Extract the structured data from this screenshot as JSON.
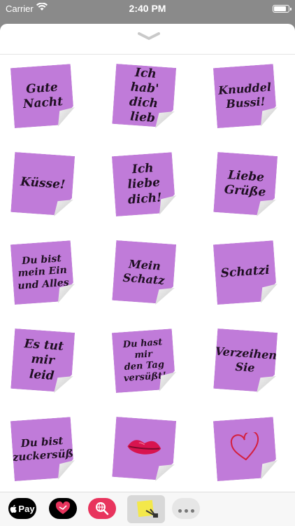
{
  "status_bar": {
    "carrier": "Carrier",
    "time": "2:40 PM"
  },
  "stickers": [
    {
      "text": "Gute\nNacht",
      "kind": "text"
    },
    {
      "text": "Ich hab'\ndich lieb",
      "kind": "text"
    },
    {
      "text": "Knuddel\nBussi!",
      "kind": "text"
    },
    {
      "text": "Küsse!",
      "kind": "text"
    },
    {
      "text": "Ich liebe\ndich!",
      "kind": "text"
    },
    {
      "text": "Liebe\nGrüße",
      "kind": "text"
    },
    {
      "text": "Du bist\nmein Ein\nund Alles",
      "kind": "text"
    },
    {
      "text": "Mein\nSchatz",
      "kind": "text"
    },
    {
      "text": "Schatzi",
      "kind": "text"
    },
    {
      "text": "Es tut\nmir leid",
      "kind": "text"
    },
    {
      "text": "Du hast mir\nden Tag\nversüßt!",
      "kind": "text"
    },
    {
      "text": "Verzeihen\nSie",
      "kind": "text"
    },
    {
      "text": "Du bist\nzuckersüß",
      "kind": "text"
    },
    {
      "text": "",
      "kind": "lips",
      "icon": "lips-icon"
    },
    {
      "text": "",
      "kind": "heart",
      "icon": "heart-outline-icon"
    }
  ],
  "app_drawer": {
    "apple_pay_label": "Pay",
    "apps": [
      "apple-pay-icon",
      "heart-app-icon",
      "search-globe-icon",
      "sticker-pack-icon",
      "more-icon"
    ]
  },
  "colors": {
    "note": "#c07bd9",
    "accent": "#e8345d"
  }
}
